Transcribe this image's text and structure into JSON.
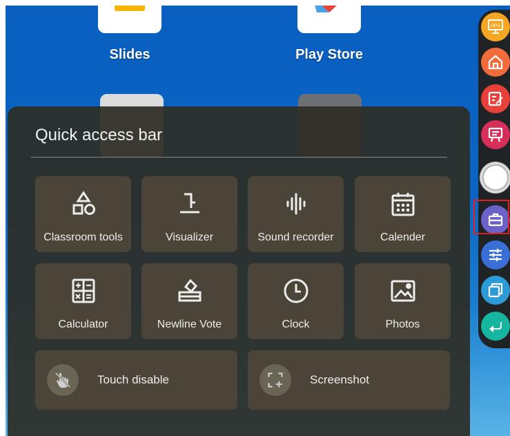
{
  "apps": [
    {
      "label": "Slides",
      "icon": "slides-icon",
      "accent": "#f4b400"
    },
    {
      "label": "Play Store",
      "icon": "play-store-icon",
      "accent": "#ea4335"
    }
  ],
  "panel": {
    "title": "Quick access bar",
    "tools": [
      {
        "label": "Classroom tools",
        "icon": "shapes-icon"
      },
      {
        "label": "Visualizer",
        "icon": "document-camera-icon"
      },
      {
        "label": "Sound recorder",
        "icon": "waveform-icon"
      },
      {
        "label": "Calender",
        "icon": "calendar-icon"
      },
      {
        "label": "Calculator",
        "icon": "calculator-icon"
      },
      {
        "label": "Newline Vote",
        "icon": "ballot-box-icon"
      },
      {
        "label": "Clock",
        "icon": "clock-icon"
      },
      {
        "label": "Photos",
        "icon": "image-icon"
      }
    ],
    "wide": [
      {
        "label": "Touch disable",
        "icon": "touch-disable-icon"
      },
      {
        "label": "Screenshot",
        "icon": "screenshot-icon"
      }
    ]
  },
  "sidebar": {
    "items": [
      {
        "name": "ops",
        "label": "OPS",
        "color": "#f5a623"
      },
      {
        "name": "home",
        "color": "#f26b3a"
      },
      {
        "name": "annotate",
        "color": "#e8413b"
      },
      {
        "name": "whiteboard",
        "color": "#d62f5a"
      },
      {
        "name": "center",
        "color": "#e0e0e0"
      },
      {
        "name": "toolbox",
        "color": "#6b62c9"
      },
      {
        "name": "settings",
        "color": "#3a6fd8"
      },
      {
        "name": "windows",
        "color": "#2b9ad6"
      },
      {
        "name": "back",
        "color": "#16b5a0"
      }
    ]
  }
}
